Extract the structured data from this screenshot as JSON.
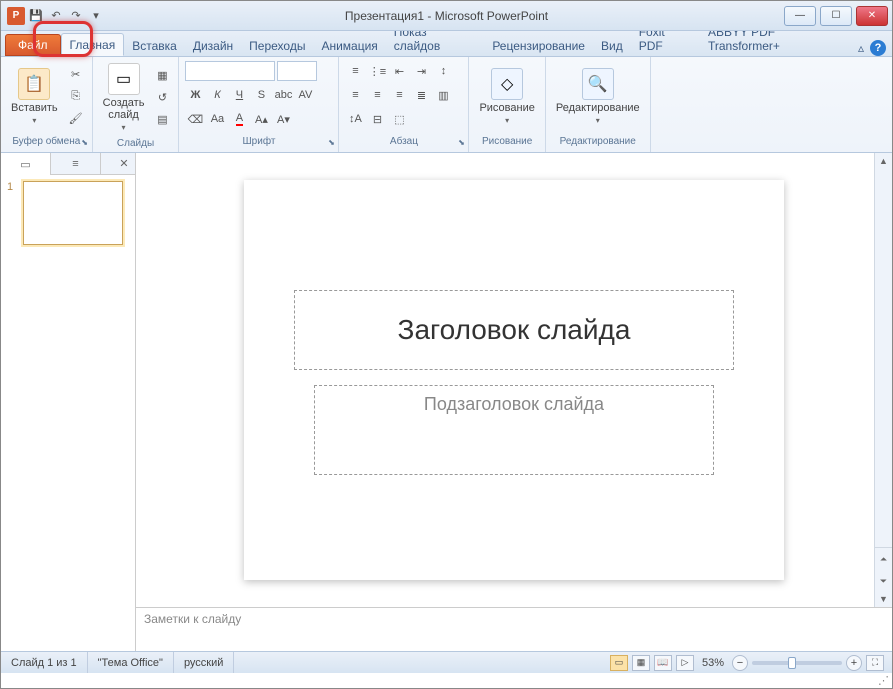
{
  "titlebar": {
    "app_icon_letter": "P",
    "title": "Презентация1 - Microsoft PowerPoint"
  },
  "tabs": {
    "file": "Файл",
    "items": [
      "Главная",
      "Вставка",
      "Дизайн",
      "Переходы",
      "Анимация",
      "Показ слайдов",
      "Рецензирование",
      "Вид",
      "Foxit PDF",
      "ABBYY PDF Transformer+"
    ],
    "active_index": 0
  },
  "ribbon": {
    "clipboard": {
      "paste": "Вставить",
      "label": "Буфер обмена"
    },
    "slides": {
      "new_slide": "Создать\nслайд",
      "label": "Слайды"
    },
    "font": {
      "label": "Шрифт"
    },
    "paragraph": {
      "label": "Абзац"
    },
    "drawing": {
      "label": "Рисование"
    },
    "editing": {
      "label": "Редактирование"
    }
  },
  "nav": {
    "thumb_number": "1"
  },
  "slide": {
    "title_placeholder": "Заголовок слайда",
    "subtitle_placeholder": "Подзаголовок слайда"
  },
  "notes": {
    "placeholder": "Заметки к слайду"
  },
  "status": {
    "slide_count": "Слайд 1 из 1",
    "theme": "\"Тема Office\"",
    "language": "русский",
    "zoom": "53%"
  }
}
